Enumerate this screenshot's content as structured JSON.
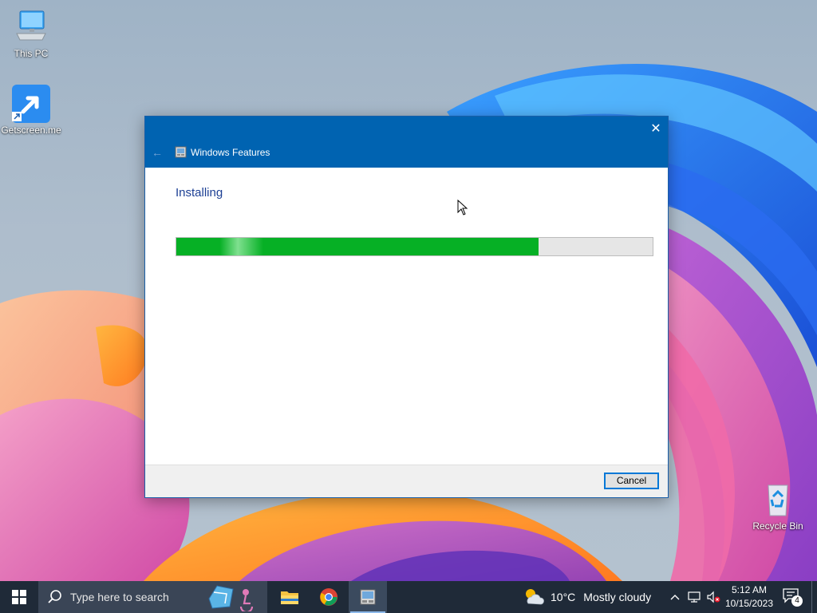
{
  "desktop": {
    "icons": {
      "this_pc": {
        "label": "This PC",
        "icon": "computer-icon"
      },
      "getscreen": {
        "label": "Getscreen.me",
        "icon": "getscreen-arrow-icon"
      },
      "recycle_bin": {
        "label": "Recycle Bin",
        "icon": "recycle-bin-icon"
      }
    }
  },
  "dialog": {
    "title": "Windows Features",
    "app_icon": "windows-features-icon",
    "heading": "Installing",
    "progress": 0.76,
    "cancel_label": "Cancel",
    "close_glyph": "✕",
    "back_glyph": "←"
  },
  "taskbar": {
    "search_placeholder": "Type here to search",
    "pinned": [
      {
        "name": "file-explorer",
        "icon": "folder-icon"
      },
      {
        "name": "chrome",
        "icon": "chrome-icon"
      },
      {
        "name": "windows-features",
        "icon": "windows-features-icon",
        "active": true
      }
    ],
    "weather": {
      "temp": "10°C",
      "condition": "Mostly cloudy",
      "icon": "partly-cloudy-icon"
    },
    "clock": {
      "time": "5:12 AM",
      "date": "10/15/2023"
    },
    "notification_count": "4"
  },
  "colors": {
    "titlebar": "#0063b1",
    "heading": "#1c3f94",
    "progress_fill": "#06b025",
    "taskbar": "#1f2a38"
  }
}
